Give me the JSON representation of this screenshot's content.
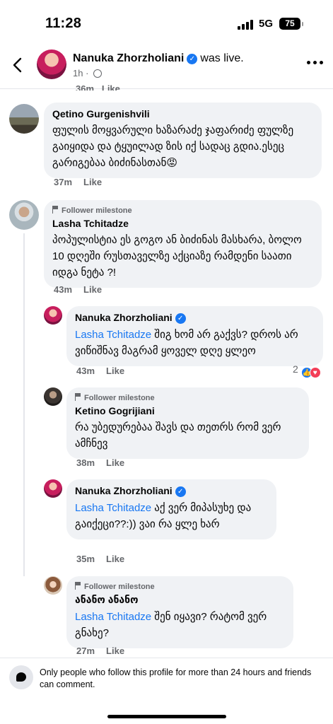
{
  "status_bar": {
    "time": "11:28",
    "network": "5G",
    "battery": "75"
  },
  "header": {
    "name": "Nanuka Zhorzholiani",
    "action": "was live.",
    "time": "1h",
    "icons": [
      "back-icon",
      "verified-icon",
      "globe-icon",
      "more-icon"
    ]
  },
  "cut_row": {
    "time": "36m",
    "like": "Like"
  },
  "comments": [
    {
      "author": "Qetino Gurgenishvili",
      "text": "ფულის მოყვარული ხაზარაძე ჯაფარიძე ფულზე გაიყიდა და ტყუილად ზის იქ სადაც გდია.ესეც გარიგებაა ბიძინასთან😡",
      "time": "37m",
      "like": "Like"
    },
    {
      "milestone": "Follower milestone",
      "author": "Lasha Tchitadze",
      "text": "პოპულისტია ეს გოგო ან ბიძინას მასხარა, ბოლო 10 დღეში რუსთაველზე აქციაზე რამდენი საათი იდგა ნეტა ?!",
      "time": "43m",
      "like": "Like"
    },
    {
      "author": "Nanuka Zhorzholiani",
      "mention": "Lasha Tchitadze",
      "text": " შიგ ხომ არ გაქვს? დროს არ ვიწიშნავ მაგრამ ყოველ დღე ყლეო",
      "time": "43m",
      "like": "Like",
      "reaction_count": "2"
    },
    {
      "milestone": "Follower milestone",
      "author": "Ketino Gogrijiani",
      "text": "რა უბედურებაა შავს და თეთრს რომ  ვერ ამჩნევ",
      "time": "38m",
      "like": "Like"
    },
    {
      "author": "Nanuka Zhorzholiani",
      "mention": "Lasha Tchitadze",
      "text": " აქ ვერ მიპასუხე და გაიქეცი??:)) ვაი რა ყლე ხარ",
      "time": "35m",
      "like": "Like"
    },
    {
      "milestone": "Follower milestone",
      "author": "ანანო ანანო",
      "mention": "Lasha Tchitadze",
      "text": " შენ იყავი? რატომ ვერ გნახე?",
      "time": "27m",
      "like": "Like"
    }
  ],
  "footer": {
    "text": "Only people who follow this profile for more than 24 hours and friends can comment."
  }
}
